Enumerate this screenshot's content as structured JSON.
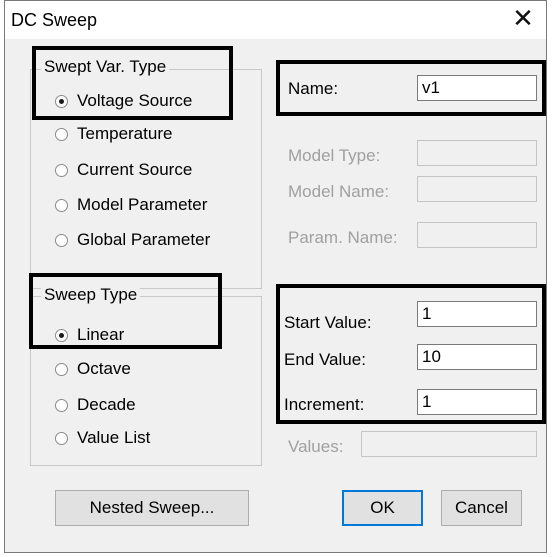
{
  "window": {
    "title": "DC Sweep",
    "close_glyph": "✕"
  },
  "swept_var": {
    "label": "Swept Var. Type",
    "options": [
      {
        "label": "Voltage Source",
        "checked": true
      },
      {
        "label": "Temperature",
        "checked": false
      },
      {
        "label": "Current Source",
        "checked": false
      },
      {
        "label": "Model Parameter",
        "checked": false
      },
      {
        "label": "Global Parameter",
        "checked": false
      }
    ]
  },
  "name_field": {
    "label": "Name:",
    "value": "v1"
  },
  "model_type": {
    "label": "Model Type:",
    "value": ""
  },
  "model_name": {
    "label": "Model Name:",
    "value": ""
  },
  "param_name": {
    "label": "Param. Name:",
    "value": ""
  },
  "sweep_type": {
    "label": "Sweep Type",
    "options": [
      {
        "label": "Linear",
        "checked": true
      },
      {
        "label": "Octave",
        "checked": false
      },
      {
        "label": "Decade",
        "checked": false
      },
      {
        "label": "Value List",
        "checked": false
      }
    ]
  },
  "start_value": {
    "label": "Start Value:",
    "value": "1"
  },
  "end_value": {
    "label": "End Value:",
    "value": "10"
  },
  "increment": {
    "label": "Increment:",
    "value": "1"
  },
  "values": {
    "label": "Values:",
    "value": ""
  },
  "buttons": {
    "nested": "Nested Sweep...",
    "ok": "OK",
    "cancel": "Cancel"
  }
}
